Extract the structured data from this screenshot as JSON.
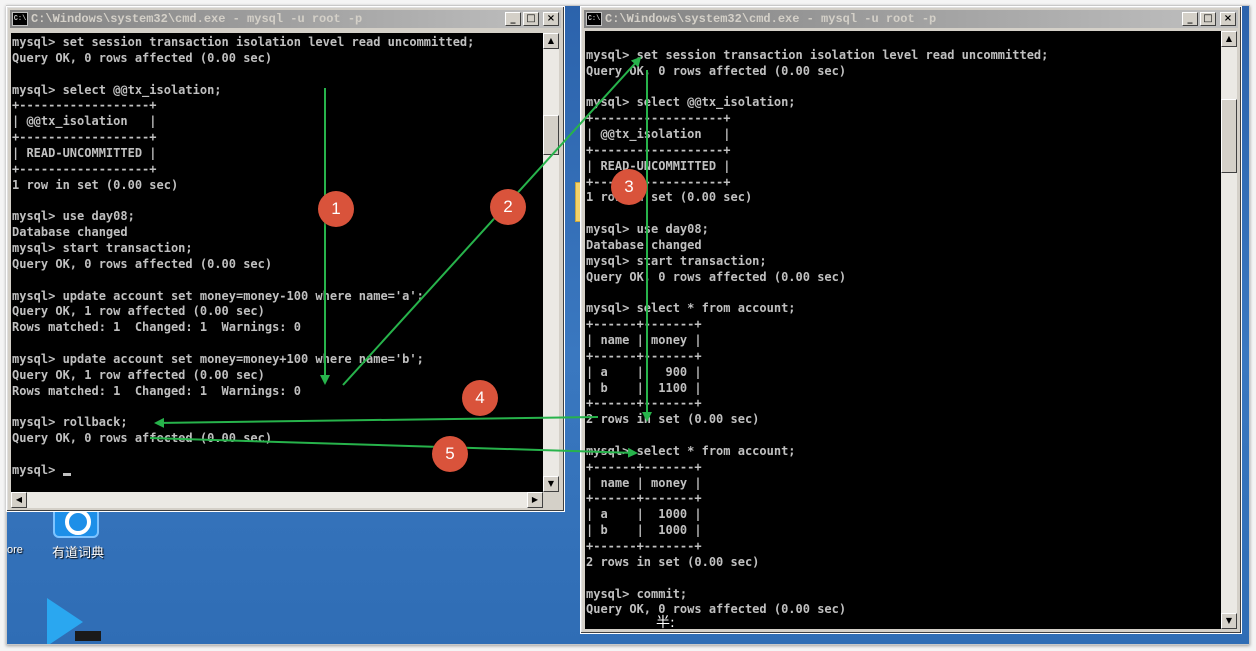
{
  "desktop": {
    "icons": [
      {
        "label": "有道词典",
        "name": "youdao-dict-icon"
      },
      {
        "label": "ore",
        "name": "partial-desktop-icon"
      }
    ]
  },
  "left_window": {
    "title": "C:\\Windows\\system32\\cmd.exe - mysql  -u root -p",
    "lines": [
      "mysql> set session transaction isolation level read uncommitted;",
      "Query OK, 0 rows affected (0.00 sec)",
      "",
      "mysql> select @@tx_isolation;",
      "+------------------+",
      "| @@tx_isolation   |",
      "+------------------+",
      "| READ-UNCOMMITTED |",
      "+------------------+",
      "1 row in set (0.00 sec)",
      "",
      "mysql> use day08;",
      "Database changed",
      "mysql> start transaction;",
      "Query OK, 0 rows affected (0.00 sec)",
      "",
      "mysql> update account set money=money-100 where name='a';",
      "Query OK, 1 row affected (0.00 sec)",
      "Rows matched: 1  Changed: 1  Warnings: 0",
      "",
      "mysql> update account set money=money+100 where name='b';",
      "Query OK, 1 row affected (0.00 sec)",
      "Rows matched: 1  Changed: 1  Warnings: 0",
      "",
      "mysql> rollback;",
      "Query OK, 0 rows affected (0.00 sec)",
      "",
      "mysql> "
    ]
  },
  "right_window": {
    "title": "C:\\Windows\\system32\\cmd.exe - mysql  -u root -p",
    "lines": [
      "",
      "mysql> set session transaction isolation level read uncommitted;",
      "Query OK, 0 rows affected (0.00 sec)",
      "",
      "mysql> select @@tx_isolation;",
      "+------------------+",
      "| @@tx_isolation   |",
      "+------------------+",
      "| READ-UNCOMMITTED |",
      "+------------------+",
      "1 row in set (0.00 sec)",
      "",
      "mysql> use day08;",
      "Database changed",
      "mysql> start transaction;",
      "Query OK, 0 rows affected (0.00 sec)",
      "",
      "mysql> select * from account;",
      "+------+-------+",
      "| name | money |",
      "+------+-------+",
      "| a    |   900 |",
      "| b    |  1100 |",
      "+------+-------+",
      "2 rows in set (0.00 sec)",
      "",
      "mysql> select * from account;",
      "+------+-------+",
      "| name | money |",
      "+------+-------+",
      "| a    |  1000 |",
      "| b    |  1000 |",
      "+------+-------+",
      "2 rows in set (0.00 sec)",
      "",
      "mysql> commit;",
      "Query OK, 0 rows affected (0.00 sec)"
    ],
    "ime_indicator": "半:"
  },
  "window_buttons": {
    "minimize": "_",
    "maximize": "□",
    "close": "×"
  },
  "step_markers": [
    "1",
    "2",
    "3",
    "4",
    "5"
  ],
  "colors": {
    "arrow": "#27b34b",
    "marker": "#d9533b",
    "console_bg": "#000000",
    "console_text": "#c0c0c0",
    "titlebar_active": "#0a246a"
  }
}
